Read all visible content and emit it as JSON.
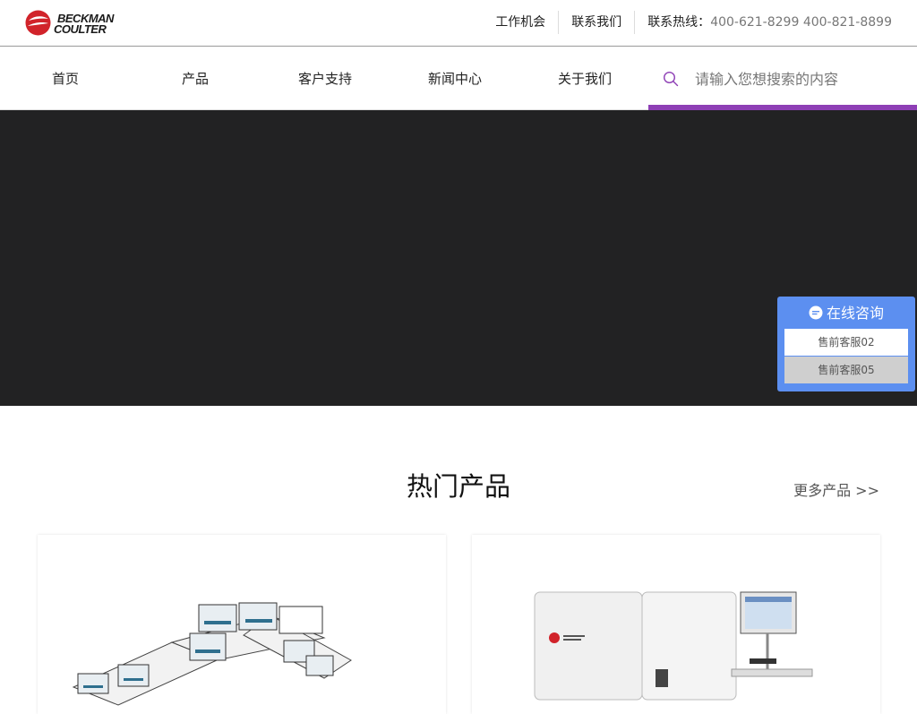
{
  "header": {
    "logo": {
      "line1": "BECKMAN",
      "line2": "COULTER"
    },
    "links": [
      {
        "label": "工作机会"
      },
      {
        "label": "联系我们"
      }
    ],
    "hotline": {
      "label": "联系热线：",
      "numbers": "400-621-8299 400-821-8899"
    }
  },
  "nav": {
    "items": [
      {
        "label": "首页"
      },
      {
        "label": "产品"
      },
      {
        "label": "客户支持"
      },
      {
        "label": "新闻中心"
      },
      {
        "label": "关于我们"
      }
    ],
    "search": {
      "placeholder": "请输入您想搜索的内容",
      "value": ""
    },
    "accent_color": "#8e3fb5"
  },
  "chat": {
    "title": "在线咨询",
    "buttons": [
      {
        "label": "售前客服02"
      },
      {
        "label": "售前客服05"
      }
    ],
    "color": "#5c8ff0"
  },
  "section": {
    "title": "热门产品",
    "more": "更多产品 >>"
  },
  "products": [
    {
      "image": "automation-line-product-image"
    },
    {
      "image": "analyzer-instrument-product-image"
    }
  ]
}
